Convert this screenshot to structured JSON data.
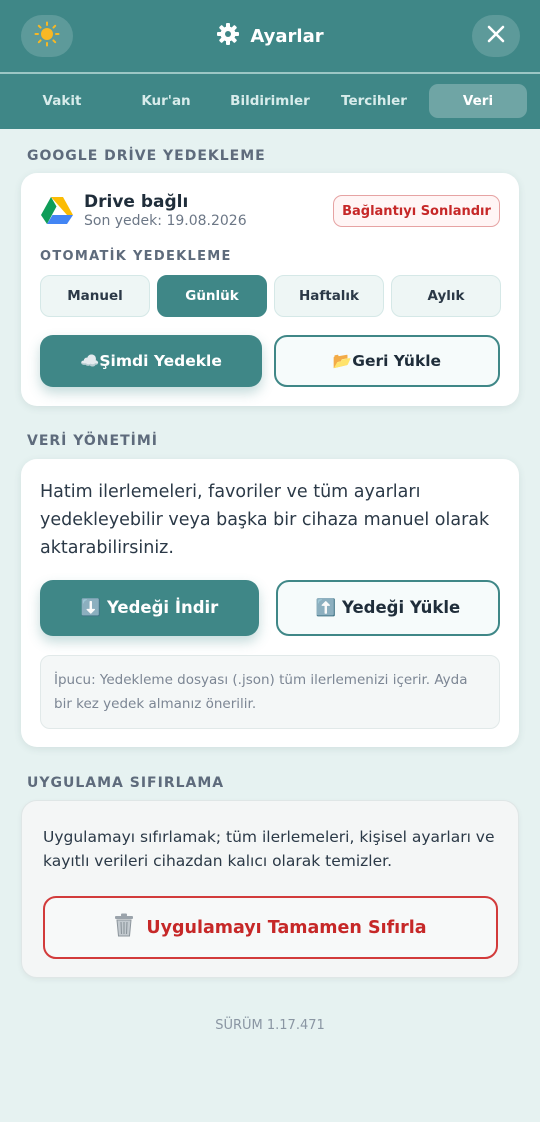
{
  "header": {
    "title": "Ayarlar",
    "theme_icon": "sun-icon",
    "title_icon": "gear-icon",
    "close_icon": "close-icon"
  },
  "tabs": [
    {
      "label": "Vakit",
      "active": false
    },
    {
      "label": "Kur'an",
      "active": false
    },
    {
      "label": "Bildirimler",
      "active": false
    },
    {
      "label": "Tercihler",
      "active": false
    },
    {
      "label": "Veri",
      "active": true
    }
  ],
  "drive": {
    "section_title": "GOOGLE DRİVE YEDEKLEME",
    "status": "Drive bağlı",
    "last_backup": "Son yedek: 19.08.2026",
    "disconnect_label": "Bağlantıyı Sonlandır",
    "auto_title": "OTOMATİK YEDEKLEME",
    "frequency_options": [
      "Manuel",
      "Günlük",
      "Haftalık",
      "Aylık"
    ],
    "selected_frequency": "Günlük",
    "backup_now_label": "☁️Şimdi Yedekle",
    "restore_label": "📂Geri Yükle"
  },
  "data_management": {
    "section_title": "VERİ YÖNETİMİ",
    "description": "Hatim ilerlemeleri, favoriler ve tüm ayarları yedekleyebilir veya başka bir cihaza manuel olarak aktarabilirsiniz.",
    "download_label": "⬇️ Yedeği İndir",
    "upload_label": "⬆️ Yedeği Yükle",
    "tip": "İpucu: Yedekleme dosyası (.json) tüm ilerlemenizi içerir. Ayda bir kez yedek almanız önerilir."
  },
  "reset": {
    "section_title": "UYGULAMA SIFIRLAMA",
    "description": "Uygulamayı sıfırlamak; tüm ilerlemeleri, kişisel ayarları ve kayıtlı verileri cihazdan kalıcı olarak temizler.",
    "button_label": "Uygulamayı Tamamen Sıfırla",
    "button_icon": "trash-icon"
  },
  "version": "SÜRÜM 1.17.471",
  "colors": {
    "primary": "#3f8787",
    "danger": "#c62828",
    "background": "#e6f2f1"
  }
}
